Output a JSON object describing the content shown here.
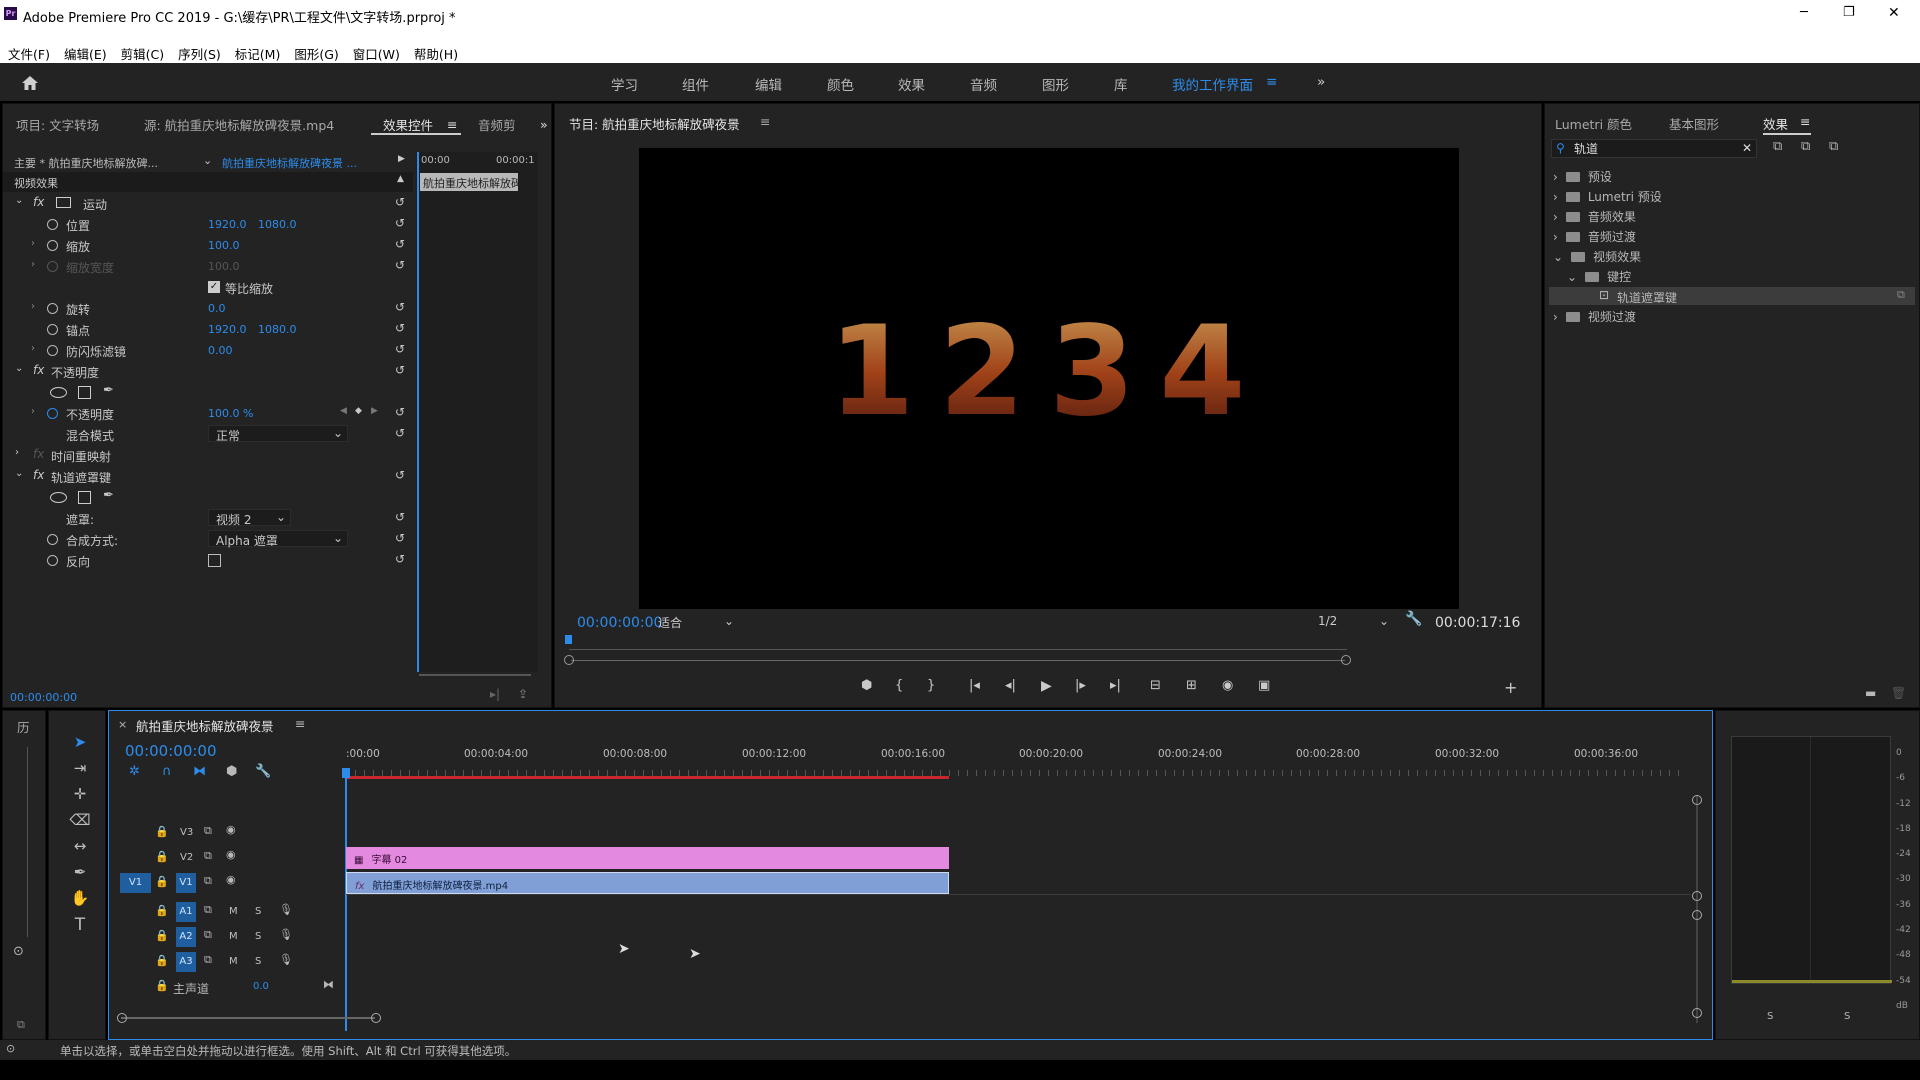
{
  "titlebar": {
    "app_icon": "Pr",
    "title": "Adobe Premiere Pro CC 2019 - G:\\缓存\\PR\\工程文件\\文字转场.prproj *",
    "minimize": "─",
    "restore": "❐",
    "close": "✕"
  },
  "menu": [
    "文件(F)",
    "编辑(E)",
    "剪辑(C)",
    "序列(S)",
    "标记(M)",
    "图形(G)",
    "窗口(W)",
    "帮助(H)"
  ],
  "workspaces": {
    "items": [
      "学习",
      "组件",
      "编辑",
      "颜色",
      "效果",
      "音频",
      "图形",
      "库"
    ],
    "active": "我的工作界面",
    "menu_icon": "≡",
    "more": "»"
  },
  "left_panel": {
    "tabs": [
      "项目: 文字转场",
      "源: 航拍重庆地标解放碑夜景.mp4",
      "效果控件",
      "音频剪"
    ],
    "active_tab": "效果控件",
    "master": "主要 * 航拍重庆地标解放碑...",
    "clip": "航拍重庆地标解放碑夜景 ...",
    "time_start": "00:00",
    "time_end": "00:00:1",
    "clip_bar": "航拍重庆地标解放碑",
    "section": "视频效果",
    "motion": "运动",
    "position": {
      "label": "位置",
      "x": "1920.0",
      "y": "1080.0"
    },
    "scale": {
      "label": "缩放",
      "value": "100.0"
    },
    "scale_width": {
      "label": "缩放宽度",
      "value": "100.0"
    },
    "uniform_scale": "等比缩放",
    "rotation": {
      "label": "旋转",
      "value": "0.0"
    },
    "anchor": {
      "label": "锚点",
      "x": "1920.0",
      "y": "1080.0"
    },
    "antiflicker": {
      "label": "防闪烁滤镜",
      "value": "0.00"
    },
    "opacity_group": "不透明度",
    "opacity": {
      "label": "不透明度",
      "value": "100.0 %"
    },
    "blend_mode": {
      "label": "混合模式",
      "value": "正常"
    },
    "time_remap": "时间重映射",
    "track_matte": "轨道遮罩键",
    "matte": {
      "label": "遮罩:",
      "value": "视频 2"
    },
    "composite": {
      "label": "合成方式:",
      "value": "Alpha 遮罩"
    },
    "reverse": "反向",
    "timecode": "00:00:00:00"
  },
  "program": {
    "title": "节目: 航拍重庆地标解放碑夜景",
    "overlay_text": "1234",
    "timecode": "00:00:00:00",
    "fit": "适合",
    "resolution": "1/2",
    "duration": "00:00:17:16"
  },
  "right_panel": {
    "tabs": [
      "Lumetri 颜色",
      "基本图形",
      "效果"
    ],
    "active_tab": "效果",
    "search_value": "轨道",
    "tree": [
      {
        "label": "预设",
        "level": 0,
        "open": false
      },
      {
        "label": "Lumetri 预设",
        "level": 0,
        "open": false
      },
      {
        "label": "音频效果",
        "level": 0,
        "open": false
      },
      {
        "label": "音频过渡",
        "level": 0,
        "open": false
      },
      {
        "label": "视频效果",
        "level": 0,
        "open": true
      },
      {
        "label": "键控",
        "level": 1,
        "open": true
      },
      {
        "label": "轨道遮罩键",
        "level": 2,
        "open": false
      },
      {
        "label": "视频过渡",
        "level": 0,
        "open": false
      }
    ]
  },
  "history_tab": "历",
  "timeline": {
    "title": "航拍重庆地标解放碑夜景",
    "timecode": "00:00:00:00",
    "ruler": [
      ":00:00",
      "00:00:04:00",
      "00:00:08:00",
      "00:00:12:00",
      "00:00:16:00",
      "00:00:20:00",
      "00:00:24:00",
      "00:00:28:00",
      "00:00:32:00",
      "00:00:36:00"
    ],
    "video_tracks": [
      "V3",
      "V2",
      "V1"
    ],
    "source_patch": "V1",
    "audio_tracks": [
      "A1",
      "A2",
      "A3"
    ],
    "mute": "M",
    "solo": "S",
    "master": {
      "label": "主声道",
      "value": "0.0"
    },
    "clip_v2": "字幕 02",
    "clip_v1": "航拍重庆地标解放碑夜景.mp4"
  },
  "meter": {
    "scale": [
      "0",
      "-6",
      "-12",
      "-18",
      "-24",
      "-30",
      "-36",
      "-42",
      "-48",
      "-54",
      "dB"
    ],
    "solo_left": "S",
    "solo_right": "S"
  },
  "status": "单击以选择，或单击空白处并拖动以进行框选。使用 Shift、Alt 和 Ctrl 可获得其他选项。",
  "colors": {
    "accent": "#2d8ceb",
    "clip_v2": "#e38ae0",
    "clip_v1": "#7f9fd6",
    "work_area": "#c8272f"
  }
}
